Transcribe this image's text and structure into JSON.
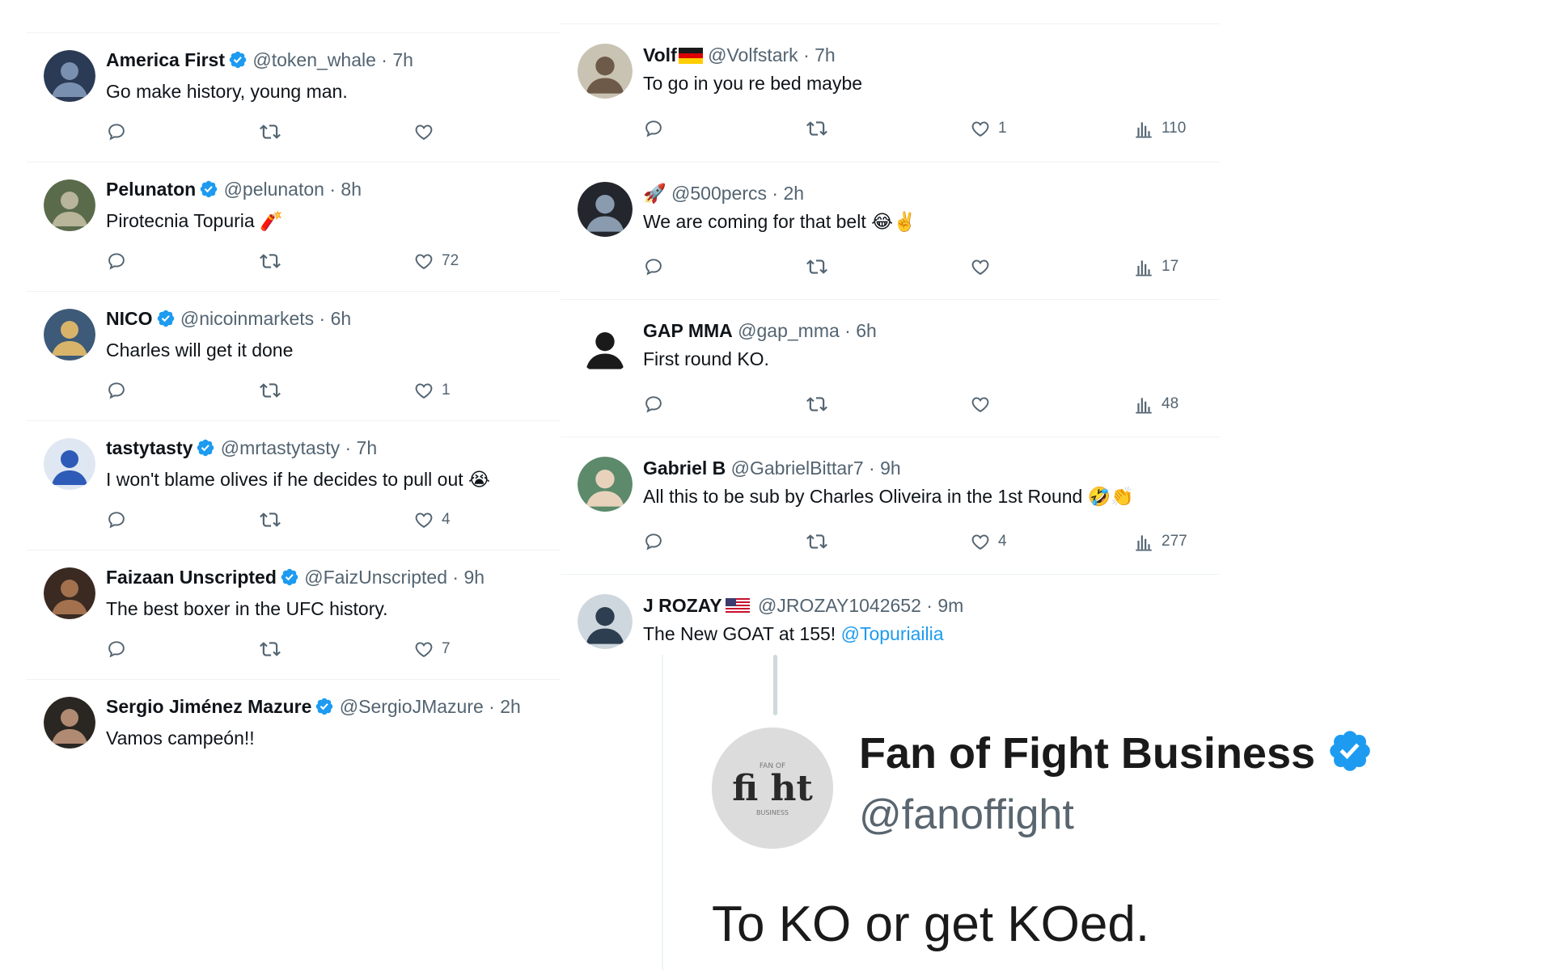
{
  "left_tweets": [
    {
      "name": "America First",
      "verified": true,
      "handle": "@token_whale",
      "time": "7h",
      "text": "Go make history, young man.",
      "likes": ""
    },
    {
      "name": "Pelunaton",
      "verified": true,
      "handle": "@pelunaton",
      "time": "8h",
      "text": "Pirotecnia Topuria",
      "emoji": "🧨",
      "likes": "72"
    },
    {
      "name": "NICO",
      "verified": true,
      "handle": "@nicoinmarkets",
      "time": "6h",
      "text": "Charles will get it done",
      "likes": "1"
    },
    {
      "name": "tastytasty",
      "verified": true,
      "handle": "@mrtastytasty",
      "time": "7h",
      "text": "I won't blame olives if he decides to pull out",
      "emoji": "😭",
      "likes": "4"
    },
    {
      "name": "Faizaan Unscripted",
      "verified": true,
      "handle": "@FaizUnscripted",
      "time": "9h",
      "text": "The best boxer in the UFC history.",
      "likes": "7"
    },
    {
      "name": "Sergio Jiménez Mazure",
      "verified": true,
      "handle": "@SergioJMazure",
      "time": "2h",
      "text": "Vamos campeón!!",
      "likes": ""
    }
  ],
  "right_tweets": [
    {
      "name": "Volf",
      "flag": "de",
      "handle": "@Volfstark",
      "time": "7h",
      "text": "To go in you re bed maybe",
      "likes": "1",
      "views": "110"
    },
    {
      "name": "🚀",
      "handle": "@500percs",
      "time": "2h",
      "text": "We are coming for that belt",
      "emoji": "😂✌️",
      "likes": "",
      "views": "17"
    },
    {
      "name": "GAP MMA",
      "handle": "@gap_mma",
      "time": "6h",
      "text": "First round KO.",
      "likes": "",
      "views": "48"
    },
    {
      "name": "Gabriel B",
      "handle": "@GabrielBittar7",
      "time": "9h",
      "text": "All this to be sub by Charles Oliveira in the 1st Round",
      "emoji": "🤣👏",
      "likes": "4",
      "views": "277"
    },
    {
      "name": "J ROZAY",
      "flag": "us",
      "handle": "@JROZAY1042652",
      "time": "9m",
      "text": "The New GOAT at 155!",
      "mention": "@Topuriailia"
    }
  ],
  "quote": {
    "name": "Fan of Fight Business",
    "handle": "@fanoffight",
    "text": "To KO or get KOed.",
    "avatar_text": "fi ht"
  },
  "colors": {
    "verified": "#1d9bf0",
    "secondary_text": "#536471",
    "link": "#1d9bf0",
    "divider": "#eff3f4"
  },
  "icons": {
    "reply": "reply-icon",
    "retweet": "retweet-icon",
    "like": "like-icon",
    "views": "views-icon",
    "verified": "verified-badge-icon"
  }
}
